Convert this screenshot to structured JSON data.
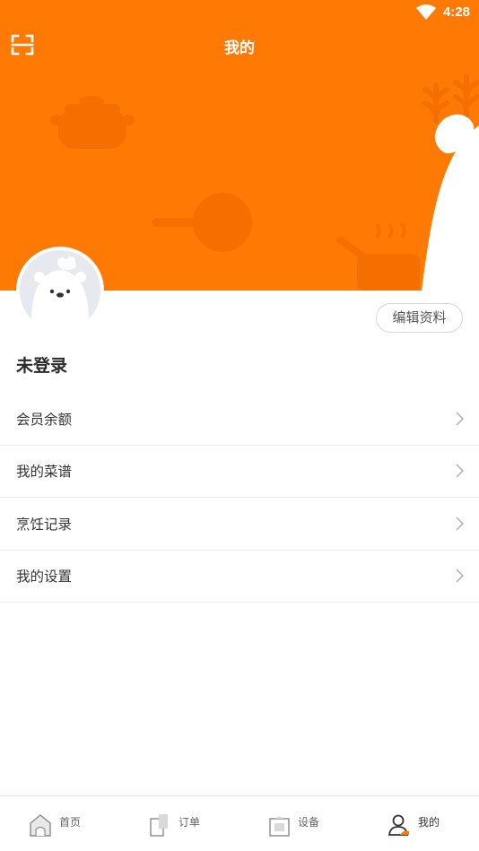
{
  "status_bar": {
    "time": "4:28",
    "wifi_icon": "wifi-icon"
  },
  "header": {
    "title": "我的",
    "scan_icon": "scan-icon",
    "background_color": "#ff7a05"
  },
  "profile": {
    "username": "未登录",
    "edit_label": "编辑资料",
    "avatar_icon": "bear-chef-avatar"
  },
  "menu": {
    "items": [
      {
        "label": "会员余额",
        "icon": "chevron-right-icon"
      },
      {
        "label": "我的菜谱",
        "icon": "chevron-right-icon"
      },
      {
        "label": "烹饪记录",
        "icon": "chevron-right-icon"
      },
      {
        "label": "我的设置",
        "icon": "chevron-right-icon"
      }
    ]
  },
  "tabbar": {
    "tabs": [
      {
        "label": "首页",
        "icon": "home-icon",
        "active": false
      },
      {
        "label": "订单",
        "icon": "order-icon",
        "active": false
      },
      {
        "label": "设备",
        "icon": "device-icon",
        "active": false
      },
      {
        "label": "我的",
        "icon": "user-icon",
        "active": true
      }
    ],
    "accent_color": "#ff7a05"
  }
}
